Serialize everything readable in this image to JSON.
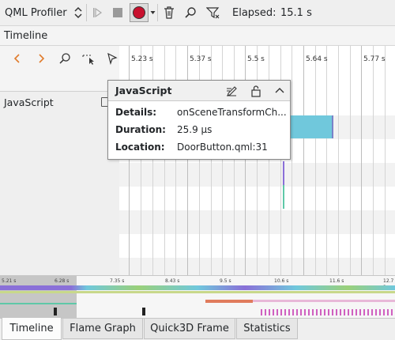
{
  "toolbar": {
    "profiler_selector": "QML Profiler",
    "elapsed_label": "Elapsed:",
    "elapsed_value": "15.1 s"
  },
  "view_bar": {
    "title": "Timeline"
  },
  "timeline": {
    "tick_labels": [
      "5.23 s",
      "5.37 s",
      "5.5 s",
      "5.64 s",
      "5.77 s"
    ]
  },
  "left_panel": {
    "category_label": "JavaScript"
  },
  "popup": {
    "title": "JavaScript",
    "details_label": "Details:",
    "details_value": "onSceneTransformCh...",
    "duration_label": "Duration:",
    "duration_value": "25.9 µs",
    "location_label": "Location:",
    "location_value": "DoorButton.qml:31"
  },
  "overview": {
    "tick_labels": [
      "5.21 s",
      "6.28 s",
      "7.35 s",
      "8.43 s",
      "9.5 s",
      "10.6 s",
      "11.6 s",
      "12.7 s"
    ]
  },
  "tabs": [
    {
      "label": "Timeline"
    },
    {
      "label": "Flame Graph"
    },
    {
      "label": "Quick3D Frame"
    },
    {
      "label": "Statistics"
    }
  ],
  "colors": {
    "accent_blue": "#70c8dc",
    "record_red": "#c8102e",
    "purple_bar": "#8a70d8",
    "teal_bar": "#5fc8a8"
  }
}
